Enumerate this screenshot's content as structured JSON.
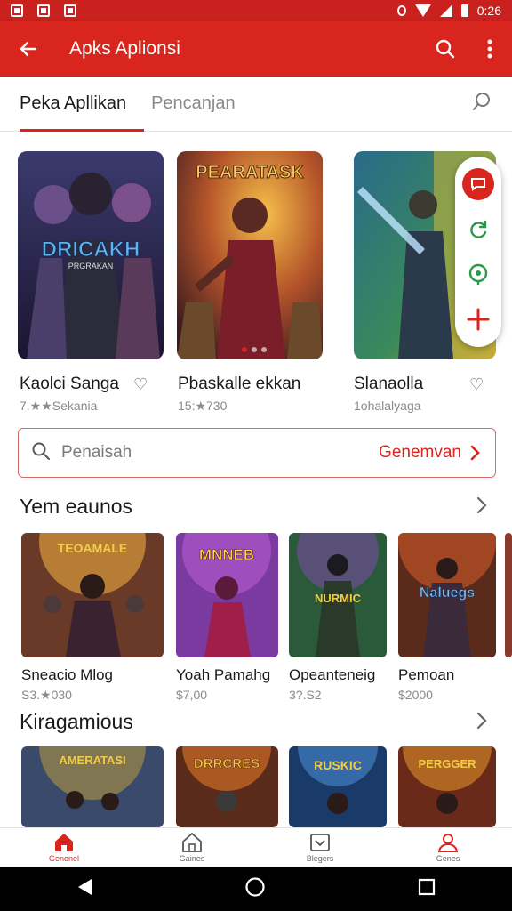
{
  "status_bar": {
    "time": "0:26"
  },
  "app_bar": {
    "title": "Apks Aplionsi"
  },
  "tabs": [
    {
      "label": "Peka Apllikan",
      "active": true
    },
    {
      "label": "Pencanjan",
      "active": false
    }
  ],
  "featured": [
    {
      "title": "Kaolci Sanga",
      "meta": "7.★★Sekania",
      "art_text": "DRICAKH",
      "art_sub": "PRGRAKAN"
    },
    {
      "title": "Pbaskalle ekkan",
      "meta": "15:★730",
      "art_text": "PEARATASK"
    },
    {
      "title": "Slanaolla",
      "meta": "1ohalalyaga"
    }
  ],
  "search": {
    "placeholder": "Penaisah",
    "action_label": "Genemvan"
  },
  "section1": {
    "title": "Yem eaunos",
    "items": [
      {
        "title": "Sneacio Mlog",
        "meta": "S3.★030",
        "art_text": "TEOAMALE"
      },
      {
        "title": "Yoah Pamahg",
        "meta": "$7,00",
        "art_text": "MNNEB"
      },
      {
        "title": "Opeanteneig",
        "meta": "3?.S2",
        "art_text": "NURMIC"
      },
      {
        "title": "Pemoan",
        "meta": "$2000",
        "art_text": "Naluegs"
      }
    ]
  },
  "section2": {
    "title": "Kiragamious",
    "items": [
      {
        "art_text": "AMERATASI"
      },
      {
        "art_text": "DRRCRES"
      },
      {
        "art_text": "RUSKIC"
      },
      {
        "art_text": "PERGGER"
      }
    ]
  },
  "bottom_nav": [
    {
      "label": "Genonel",
      "icon": "home-icon",
      "active": true
    },
    {
      "label": "Gaines",
      "icon": "store-icon",
      "active": false
    },
    {
      "label": "Blegers",
      "icon": "inbox-icon",
      "active": false
    },
    {
      "label": "Genes",
      "icon": "profile-icon",
      "active": false
    }
  ],
  "colors": {
    "brand_red": "#d8261f",
    "status_red": "#c8211e"
  }
}
